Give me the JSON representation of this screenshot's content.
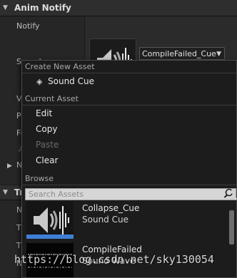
{
  "details": {
    "anim_notify_header": "Anim Notify",
    "notify_label": "Notify",
    "sound_label": "Sound",
    "partial_labels": [
      "V",
      "P",
      "Fo",
      "A",
      "N"
    ],
    "second_header_partial": "Tr",
    "second_partial_labels": [
      "N",
      "T",
      "T",
      "N"
    ],
    "sound_value": "CompileFailed_Cue"
  },
  "menu": {
    "create_new_heading": "Create New Asset",
    "create_item": "Sound Cue",
    "current_heading": "Current Asset",
    "items": [
      {
        "label": "Edit",
        "enabled": true
      },
      {
        "label": "Copy",
        "enabled": true
      },
      {
        "label": "Paste",
        "enabled": false
      },
      {
        "label": "Clear",
        "enabled": true
      }
    ],
    "browse_heading": "Browse",
    "search_placeholder": "Search Assets",
    "assets": [
      {
        "name": "Collapse_Cue",
        "type": "Sound Cue"
      },
      {
        "name": "CompileFailed",
        "type": "Sound Wave"
      }
    ]
  },
  "watermark": "https://blog.csdn.net/sky130054",
  "colors": {
    "background": "#1a1a1a",
    "header": "#2e2e2e",
    "thumb_blue": "#3f7fd6"
  }
}
